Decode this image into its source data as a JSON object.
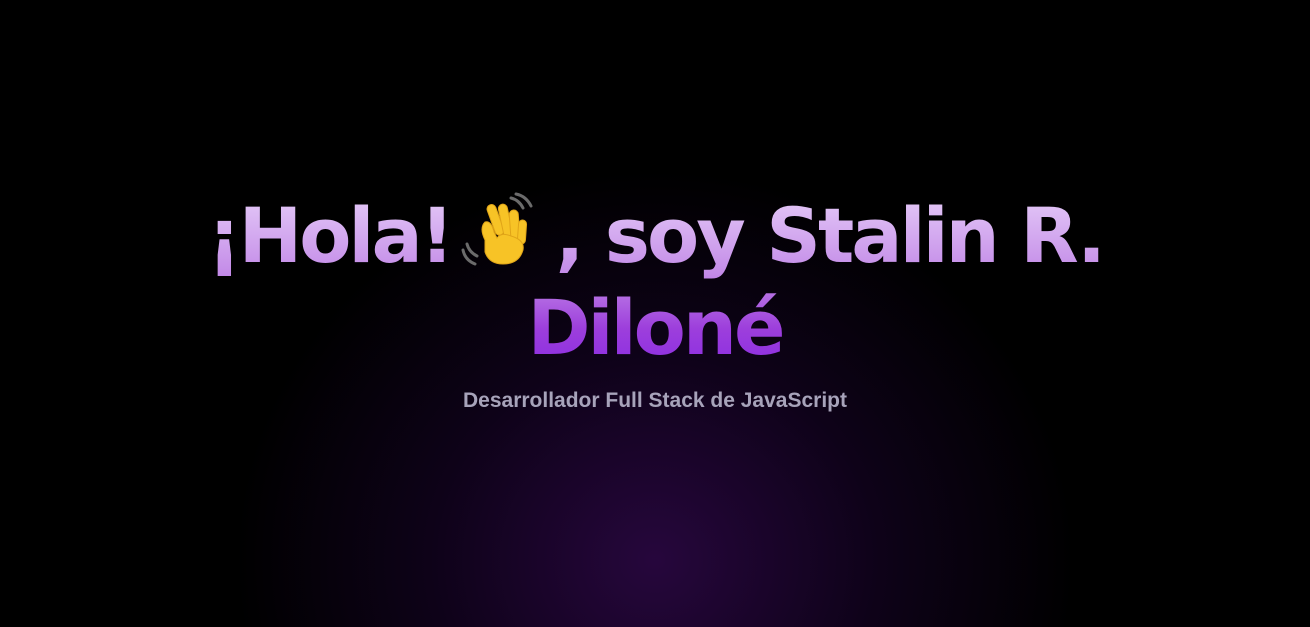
{
  "hero": {
    "greeting": "¡Hola!",
    "greeting_icon": "waving-hand-icon",
    "name_prefix": ", soy Stalin R.",
    "name_line2": "Diloné",
    "subtitle": "Desarrollador Full Stack de JavaScript"
  },
  "colors": {
    "background": "#000000",
    "accent_glow": "#460c6e",
    "heading_top": "#e6cdf8",
    "heading_bottom": "#8a2be2",
    "subtitle": "#a7a3ba"
  }
}
